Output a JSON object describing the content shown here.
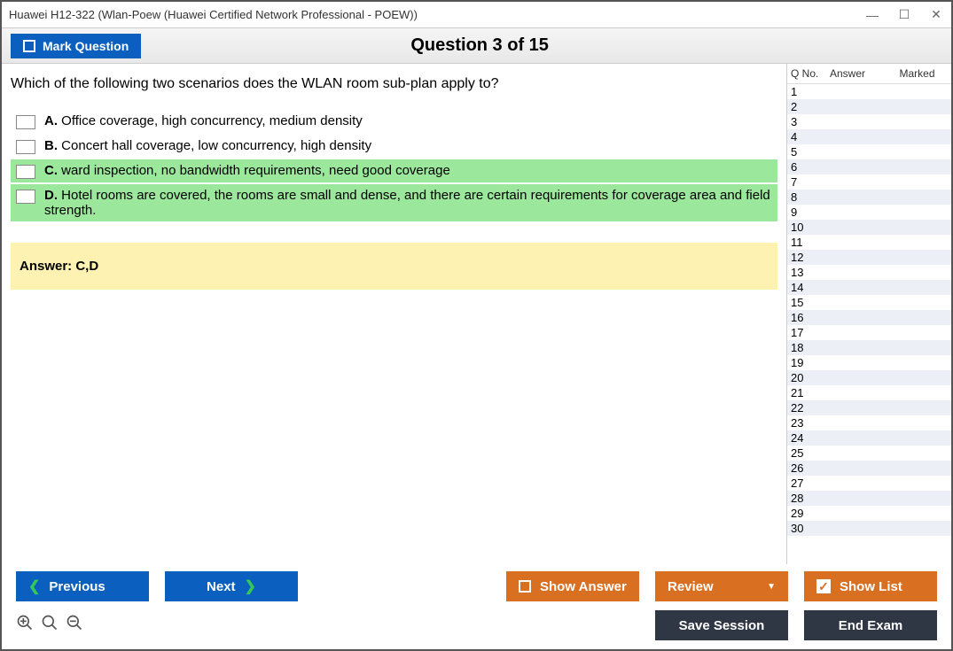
{
  "window": {
    "title": "Huawei H12-322 (Wlan-Poew (Huawei Certified Network Professional - POEW))"
  },
  "toolbar": {
    "mark_label": "Mark Question",
    "question_title": "Question 3 of 15"
  },
  "question": {
    "text": "Which of the following two scenarios does the WLAN room sub-plan apply to?",
    "options": [
      {
        "letter": "A.",
        "text": "Office coverage, high concurrency, medium density",
        "correct": false
      },
      {
        "letter": "B.",
        "text": "Concert hall coverage, low concurrency, high density",
        "correct": false
      },
      {
        "letter": "C.",
        "text": "ward inspection, no bandwidth requirements, need good coverage",
        "correct": true
      },
      {
        "letter": "D.",
        "text": "Hotel rooms are covered, the rooms are small and dense, and there are certain requirements for coverage area and field strength.",
        "correct": true
      }
    ],
    "answer_label": "Answer: C,D"
  },
  "sidebar": {
    "headers": {
      "qno": "Q No.",
      "answer": "Answer",
      "marked": "Marked"
    },
    "rows": [
      {
        "n": "1"
      },
      {
        "n": "2"
      },
      {
        "n": "3"
      },
      {
        "n": "4"
      },
      {
        "n": "5"
      },
      {
        "n": "6"
      },
      {
        "n": "7"
      },
      {
        "n": "8"
      },
      {
        "n": "9"
      },
      {
        "n": "10"
      },
      {
        "n": "11"
      },
      {
        "n": "12"
      },
      {
        "n": "13"
      },
      {
        "n": "14"
      },
      {
        "n": "15"
      },
      {
        "n": "16"
      },
      {
        "n": "17"
      },
      {
        "n": "18"
      },
      {
        "n": "19"
      },
      {
        "n": "20"
      },
      {
        "n": "21"
      },
      {
        "n": "22"
      },
      {
        "n": "23"
      },
      {
        "n": "24"
      },
      {
        "n": "25"
      },
      {
        "n": "26"
      },
      {
        "n": "27"
      },
      {
        "n": "28"
      },
      {
        "n": "29"
      },
      {
        "n": "30"
      }
    ]
  },
  "buttons": {
    "previous": "Previous",
    "next": "Next",
    "show_answer": "Show Answer",
    "review": "Review",
    "show_list": "Show List",
    "save_session": "Save Session",
    "end_exam": "End Exam"
  }
}
